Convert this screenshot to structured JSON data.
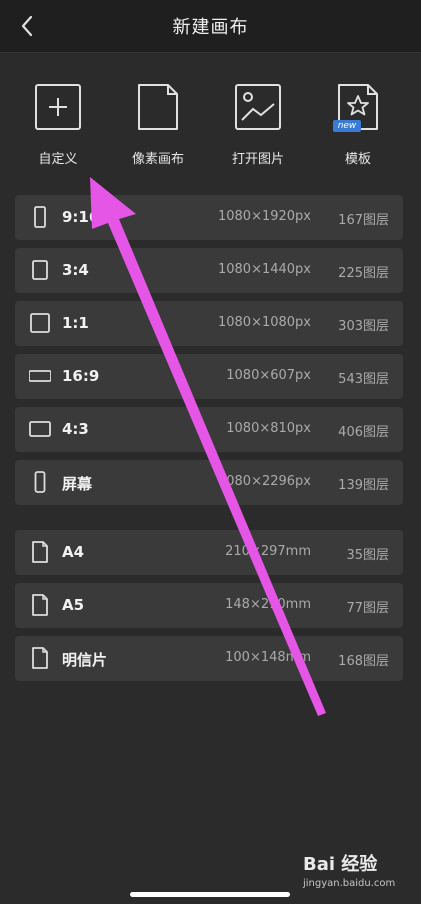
{
  "header": {
    "title": "新建画布",
    "back_icon": "chevron-left-icon"
  },
  "shortcuts": [
    {
      "label": "自定义",
      "icon": "plus-square-icon"
    },
    {
      "label": "像素画布",
      "icon": "blank-page-icon"
    },
    {
      "label": "打开图片",
      "icon": "image-icon"
    },
    {
      "label": "模板",
      "icon": "star-document-icon",
      "badge": "new"
    }
  ],
  "presets": [
    {
      "name": "9:16",
      "size": "1080×1920px",
      "layers": "167图层",
      "icon": "portrait-tall-icon"
    },
    {
      "name": "3:4",
      "size": "1080×1440px",
      "layers": "225图层",
      "icon": "portrait-icon"
    },
    {
      "name": "1:1",
      "size": "1080×1080px",
      "layers": "303图层",
      "icon": "square-icon"
    },
    {
      "name": "16:9",
      "size": "1080×607px",
      "layers": "543图层",
      "icon": "landscape-wide-icon"
    },
    {
      "name": "4:3",
      "size": "1080×810px",
      "layers": "406图层",
      "icon": "landscape-icon"
    },
    {
      "name": "屏幕",
      "size": "1080×2296px",
      "layers": "139图层",
      "icon": "phone-screen-icon"
    }
  ],
  "paper": [
    {
      "name": "A4",
      "size": "210×297mm",
      "layers": "35图层",
      "icon": "document-icon"
    },
    {
      "name": "A5",
      "size": "148×210mm",
      "layers": "77图层",
      "icon": "document-icon"
    },
    {
      "name": "明信片",
      "size": "100×148mm",
      "layers": "168图层",
      "icon": "document-icon"
    }
  ],
  "colors": {
    "annotation_arrow": "#e556e6",
    "badge": "#3a7bd5",
    "row_bg": "#3a3a3a",
    "page_bg": "#2b2b2b"
  },
  "watermark": {
    "line1": "Bai 经验",
    "line2": "jingyan.baidu.com"
  }
}
